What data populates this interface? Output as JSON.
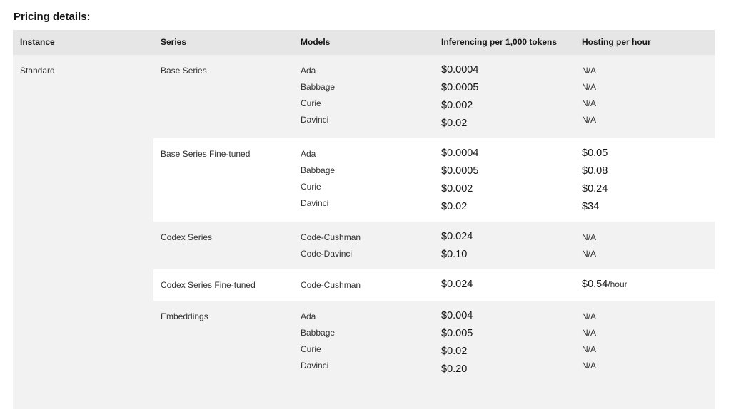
{
  "page": {
    "title": "Pricing details:"
  },
  "table": {
    "headers": [
      "Instance",
      "Series",
      "Models",
      "Inferencing per 1,000 tokens",
      "Hosting per hour"
    ],
    "instance": "Standard",
    "groups": [
      {
        "series": "Base Series",
        "rows": [
          {
            "model": "Ada",
            "inferencing": "$0.0004",
            "hosting": "N/A"
          },
          {
            "model": "Babbage",
            "inferencing": "$0.0005",
            "hosting": "N/A"
          },
          {
            "model": "Curie",
            "inferencing": "$0.002",
            "hosting": "N/A"
          },
          {
            "model": "Davinci",
            "inferencing": "$0.02",
            "hosting": "N/A"
          }
        ]
      },
      {
        "series": "Base Series Fine-tuned",
        "rows": [
          {
            "model": "Ada",
            "inferencing": "$0.0004",
            "hosting": "$0.05"
          },
          {
            "model": "Babbage",
            "inferencing": "$0.0005",
            "hosting": "$0.08"
          },
          {
            "model": "Curie",
            "inferencing": "$0.002",
            "hosting": "$0.24"
          },
          {
            "model": "Davinci",
            "inferencing": "$0.02",
            "hosting": "$34"
          }
        ]
      },
      {
        "series": "Codex Series",
        "rows": [
          {
            "model": "Code-Cushman",
            "inferencing": "$0.024",
            "hosting": "N/A"
          },
          {
            "model": "Code-Davinci",
            "inferencing": "$0.10",
            "hosting": "N/A"
          }
        ]
      },
      {
        "series": "Codex Series Fine-tuned",
        "rows": [
          {
            "model": "Code-Cushman",
            "inferencing": "$0.024",
            "hosting": "$0.54",
            "hosting_suffix": "/hour"
          }
        ]
      },
      {
        "series": "Embeddings",
        "rows": [
          {
            "model": "Ada",
            "inferencing": "$0.004",
            "hosting": "N/A"
          },
          {
            "model": "Babbage",
            "inferencing": "$0.005",
            "hosting": "N/A"
          },
          {
            "model": "Curie",
            "inferencing": "$0.02",
            "hosting": "N/A"
          },
          {
            "model": "Davinci",
            "inferencing": "$0.20",
            "hosting": "N/A"
          }
        ]
      }
    ]
  }
}
